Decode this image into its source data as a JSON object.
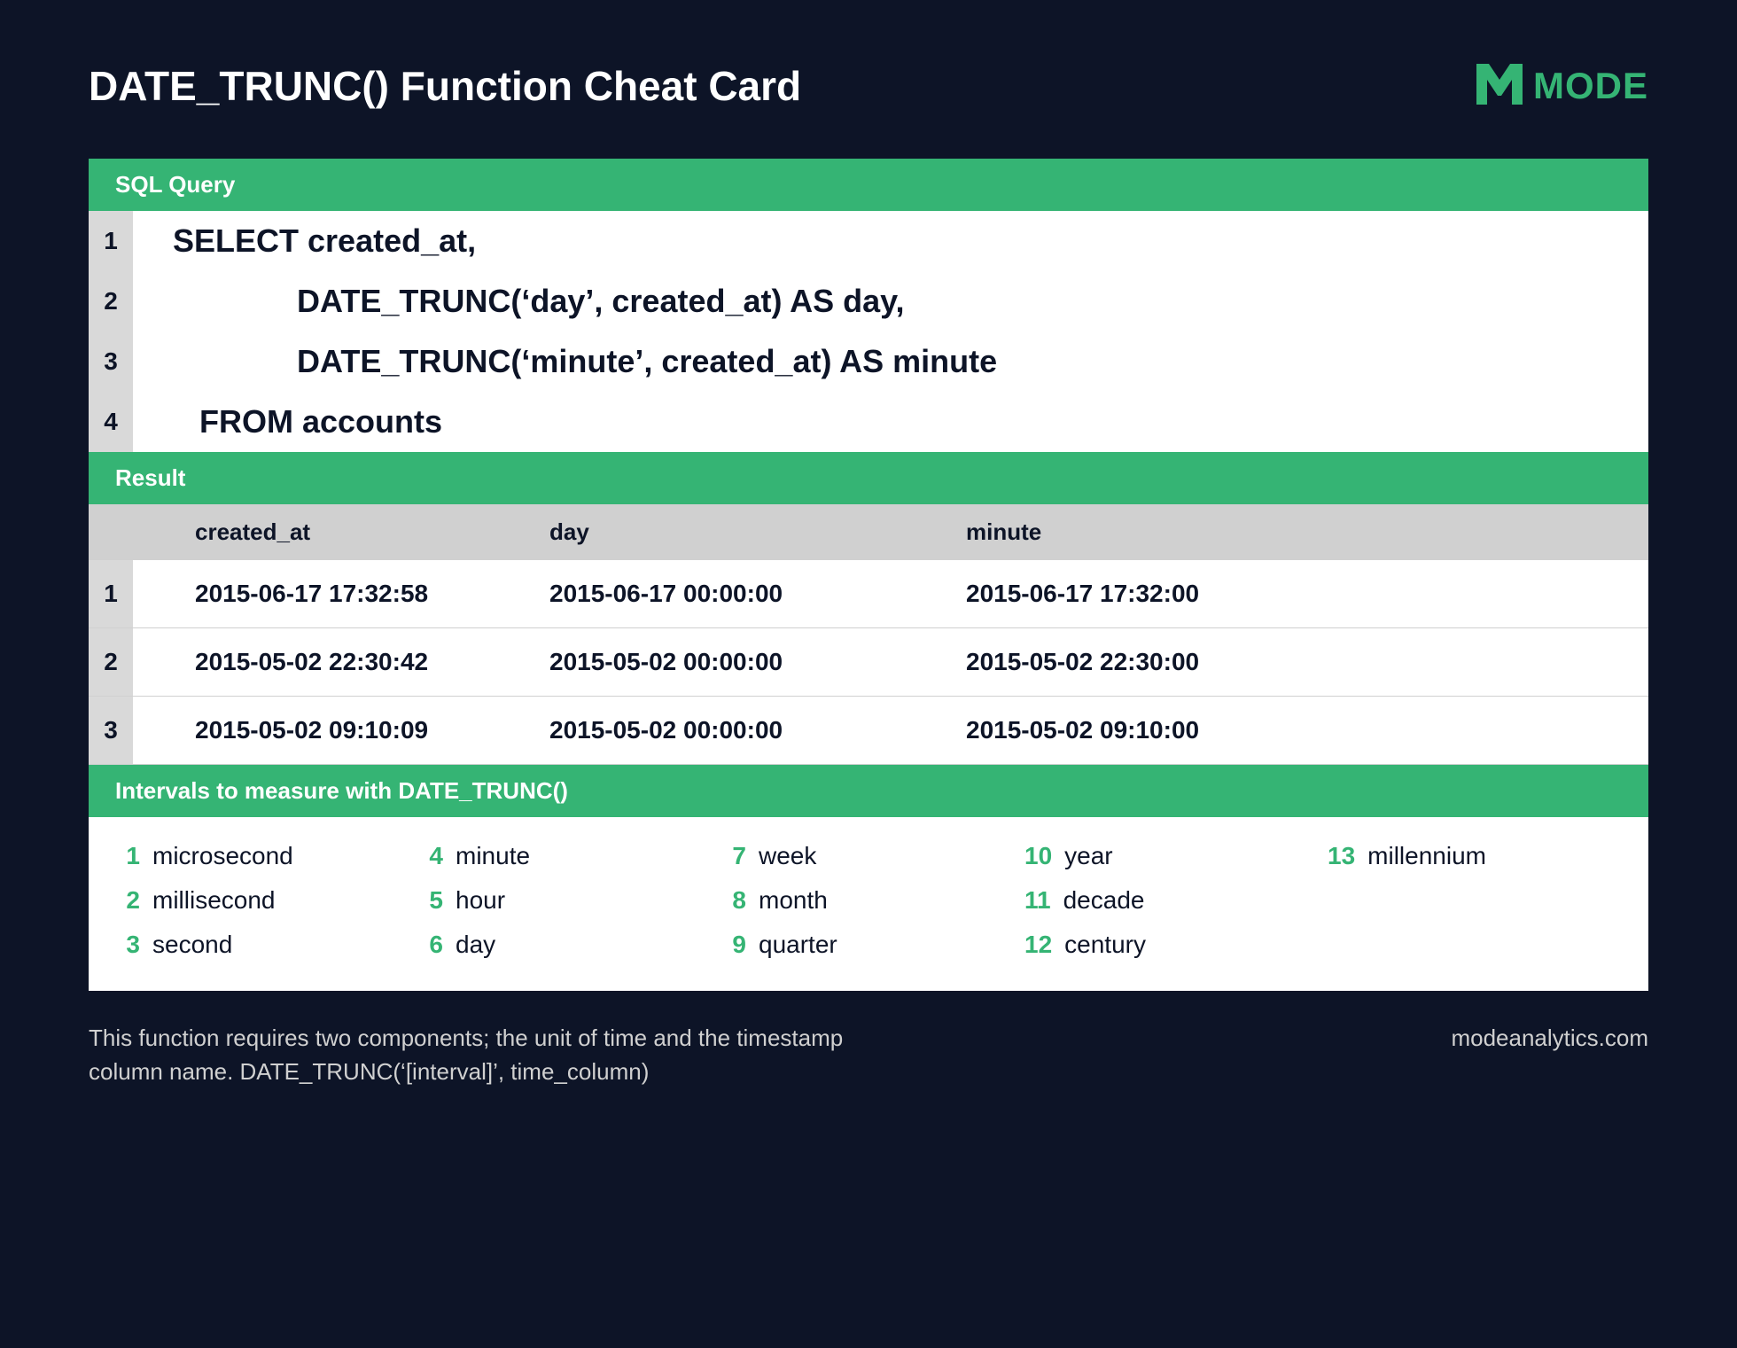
{
  "header": {
    "title": "DATE_TRUNC() Function Cheat Card",
    "brand": "MODE"
  },
  "sql": {
    "section_label": "SQL Query",
    "lines": [
      {
        "n": "1",
        "code": "SELECT created_at,"
      },
      {
        "n": "2",
        "code": "              DATE_TRUNC(‘day’, created_at) AS day,"
      },
      {
        "n": "3",
        "code": "              DATE_TRUNC(‘minute’, created_at) AS minute"
      },
      {
        "n": "4",
        "code": "   FROM accounts"
      }
    ]
  },
  "result": {
    "section_label": "Result",
    "columns": [
      "created_at",
      "day",
      "minute"
    ],
    "rows": [
      {
        "n": "1",
        "cells": [
          "2015-06-17  17:32:58",
          "2015-06-17  00:00:00",
          "2015-06-17  17:32:00"
        ]
      },
      {
        "n": "2",
        "cells": [
          "2015-05-02  22:30:42",
          "2015-05-02  00:00:00",
          "2015-05-02  22:30:00"
        ]
      },
      {
        "n": "3",
        "cells": [
          "2015-05-02  09:10:09",
          "2015-05-02  00:00:00",
          "2015-05-02  09:10:00"
        ]
      }
    ]
  },
  "intervals": {
    "section_label": "Intervals to measure with DATE_TRUNC()",
    "items": [
      {
        "n": "1",
        "label": "microsecond"
      },
      {
        "n": "2",
        "label": "millisecond"
      },
      {
        "n": "3",
        "label": "second"
      },
      {
        "n": "4",
        "label": "minute"
      },
      {
        "n": "5",
        "label": "hour"
      },
      {
        "n": "6",
        "label": "day"
      },
      {
        "n": "7",
        "label": "week"
      },
      {
        "n": "8",
        "label": "month"
      },
      {
        "n": "9",
        "label": "quarter"
      },
      {
        "n": "10",
        "label": "year"
      },
      {
        "n": "11",
        "label": "decade"
      },
      {
        "n": "12",
        "label": "century"
      },
      {
        "n": "13",
        "label": "millennium"
      }
    ]
  },
  "footer": {
    "note": "This function requires two components; the unit of time and the timestamp column name. DATE_TRUNC(‘[interval]’, time_column)",
    "site": "modeanalytics.com"
  }
}
